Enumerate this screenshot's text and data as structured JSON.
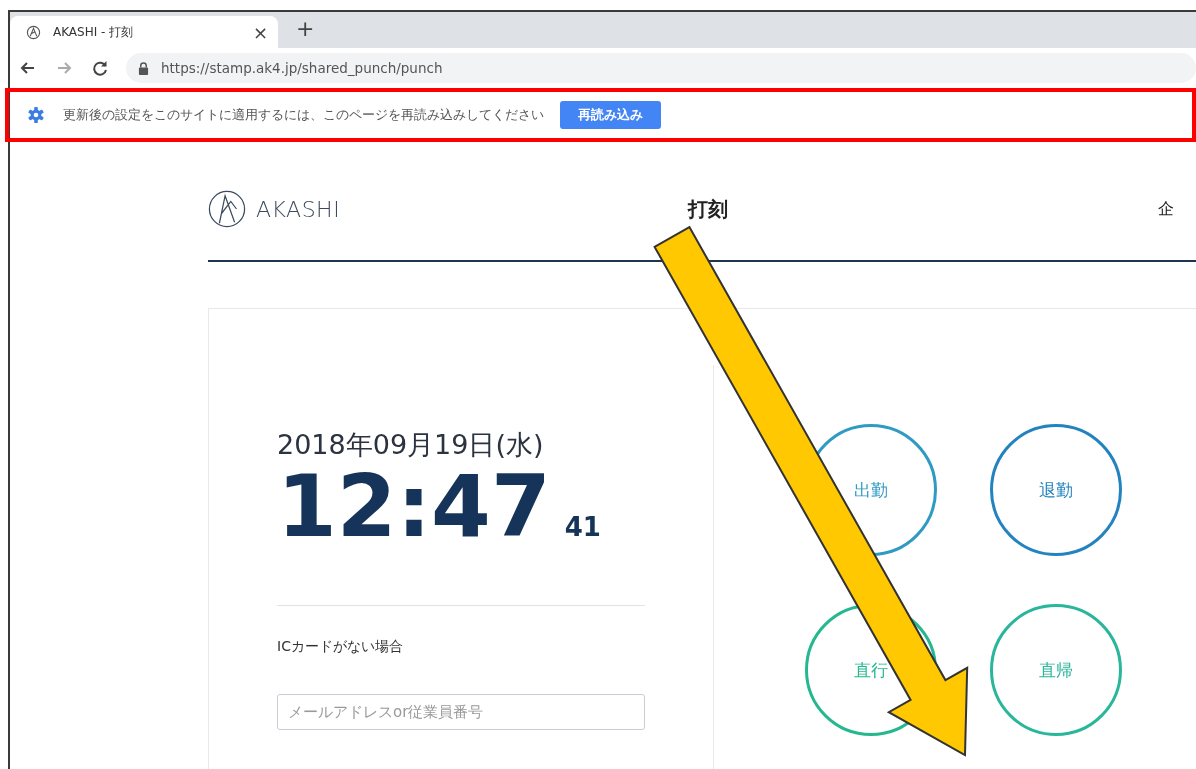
{
  "browser": {
    "tab_title": "AKASHI - 打刻",
    "close": "×",
    "new_tab": "+",
    "url": "https://stamp.ak4.jp/shared_punch/punch"
  },
  "infobar": {
    "message": "更新後の設定をこのサイトに適用するには、このページを再読み込みしてください",
    "button": "再読み込み",
    "highlighted": true
  },
  "header": {
    "logo": "AKASHI",
    "title": "打刻",
    "nav_item": "企"
  },
  "clock": {
    "date": "2018年09月19日(水)",
    "time": "12:47",
    "seconds": "41"
  },
  "manual": {
    "label": "ICカードがない場合",
    "placeholder": "メールアドレスor従業員番号"
  },
  "punch_buttons": [
    {
      "label": "出勤",
      "color": "#2f9ac2"
    },
    {
      "label": "退勤",
      "color": "#2383bf"
    },
    {
      "label": "直行",
      "color": "#25b88f"
    },
    {
      "label": "直帰",
      "color": "#2ab69a"
    }
  ],
  "annotation": {
    "kind": "arrow"
  }
}
